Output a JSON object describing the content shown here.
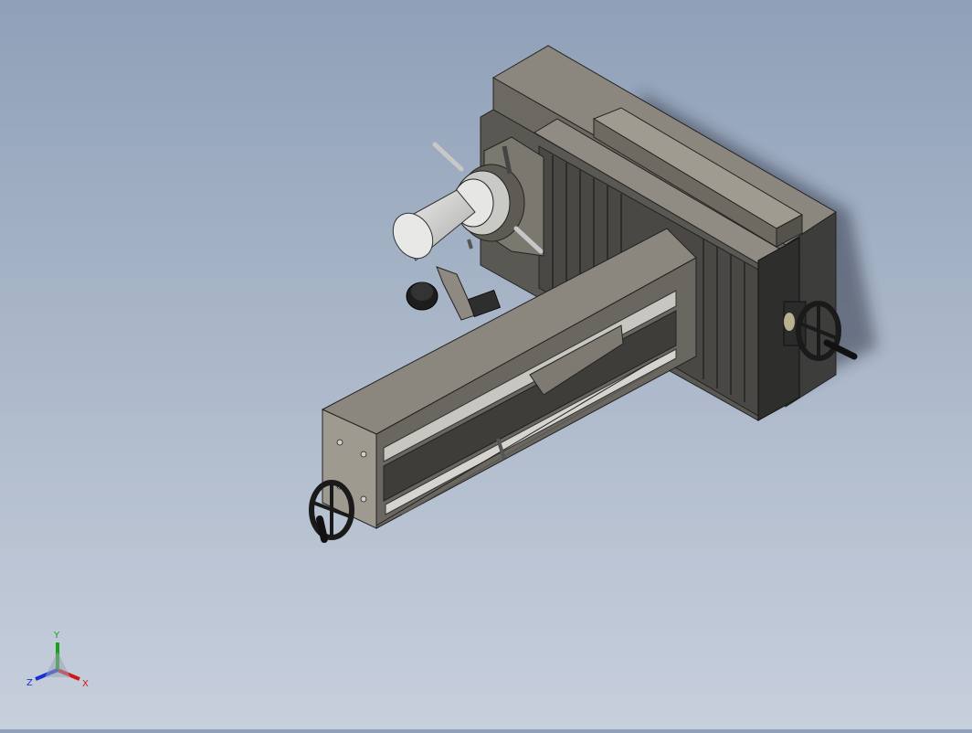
{
  "window": {
    "title": ""
  },
  "triad": {
    "x_label": "X",
    "y_label": "Y",
    "z_label": "Z",
    "x_color": "#d01818",
    "y_color": "#18a018",
    "z_color": "#1830d0"
  },
  "model": {
    "body_color": "#7e7a72",
    "body_dark": "#3a3a3a",
    "handwheel_color": "#1a1a1a"
  }
}
